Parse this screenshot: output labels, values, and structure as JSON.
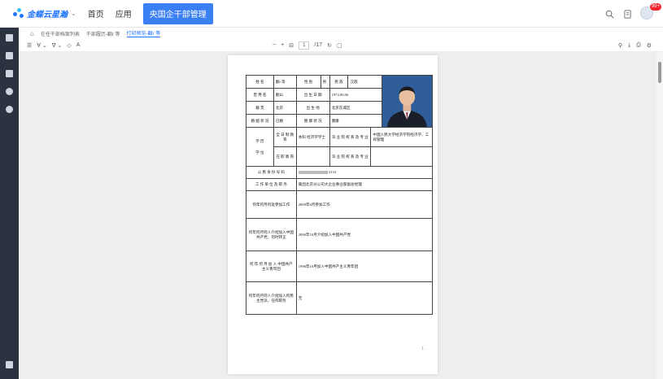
{
  "app": {
    "logo_text": "金蝶云星瀚",
    "logo_sub": "",
    "nav": [
      "首页",
      "应用"
    ],
    "active_app": "央国企干部管理",
    "badge": "99+"
  },
  "breadcrumbs": [
    "在任干部档案列表",
    "干部履历-翻r 等",
    "打印预览-翻r 等"
  ],
  "toolbar": {
    "current_page": "1",
    "total_pages": "/17"
  },
  "form": {
    "name_label": "姓 名",
    "name_value": "翻r 等",
    "gender_label": "性 别",
    "gender_value": "男",
    "ethnic_label": "民 族",
    "ethnic_value": "汉族",
    "former_name_label": "曾 用 名",
    "former_name_value": "翻山",
    "birth_label": "出 生 日 期",
    "birth_value": "1974.06.06",
    "native_label": "籍 贯",
    "native_value": "北京",
    "birthplace_label": "出 生 地",
    "birthplace_value": "北京东城区",
    "marital_label": "婚 姻 状 况",
    "marital_value": "已婚",
    "health_label": "健 康 状 况",
    "health_value": "健康",
    "edu_label": "学 历",
    "degree_label": "学 位",
    "fulltime_label": "全 日 制 教 育",
    "fulltime_value": "本科 经济学学士",
    "school_label": "毕 业 院 校 系 及 专 业",
    "school_value": "中国人民大学经济学院经济学、工商管理",
    "parttime_label": "在 职 教 育",
    "school2_label": "毕 业 院 校 系 及 专 业",
    "id_label": "公 民 身 份 号 码",
    "id_value": "2133",
    "job_label": "工 作 单 位 及 职 务",
    "job_value": "集团北京分公司大企业事业部副总经理",
    "work_start_label": "何年何月何处参加工作",
    "work_start_value": "2009年6月参加工作",
    "party_label": "何年何月何人介绍加入中国共产党，何时转正",
    "party_value": "2006年10月介绍加入中国共产党",
    "league_label": "何 年 何 月 加 入 中国共产主义青年团",
    "league_value": "1996年10月加入中国共产主义青年团",
    "democratic_label": "何年何月何人介绍加入何民主党派，任何职务",
    "democratic_value": "无"
  },
  "colors": {
    "accent": "#3b7ff5",
    "sidebar": "#2c3340",
    "photo_bg": "#2e5d9a"
  }
}
